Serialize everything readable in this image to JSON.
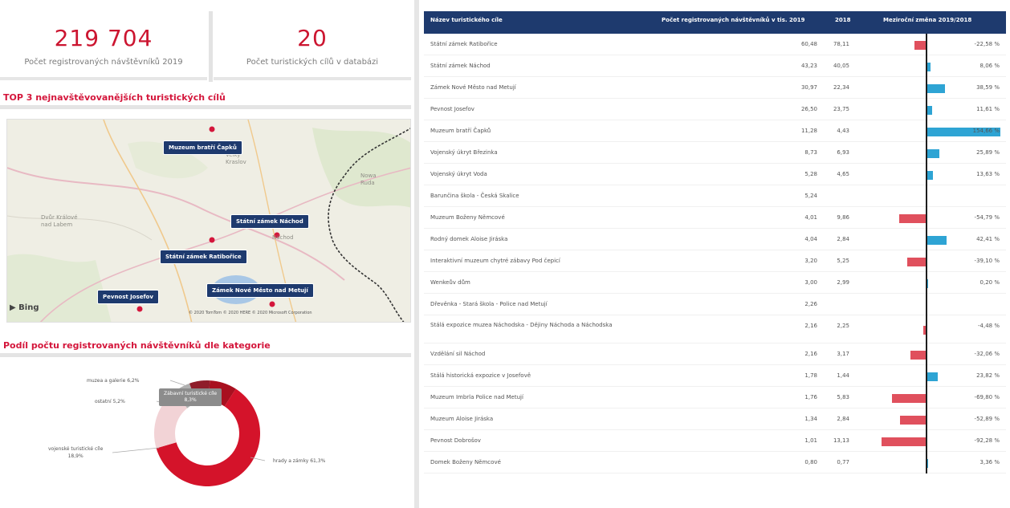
{
  "kpis": [
    {
      "value": "219 704",
      "label": "Počet registrovaných návštěvníků 2019"
    },
    {
      "value": "20",
      "label": "Počet turistických cílů v databázi"
    }
  ],
  "sections": {
    "top3_title": "TOP 3 nejnavštěvovanějších turistických cílů",
    "category_title": "Podíl počtu registrovaných návštěvníků dle kategorie"
  },
  "map": {
    "markers": [
      {
        "label": "Muzeum bratří Čapků"
      },
      {
        "label": "Státní zámek Náchod"
      },
      {
        "label": "Státní zámek Ratibořice"
      },
      {
        "label": "Zámek Nové Město nad Metují"
      },
      {
        "label": "Pevnost Josefov"
      }
    ],
    "bing": "Bing",
    "copyright": "© 2020 TomTom © 2020 HERE © 2020 Microsoft Corporation"
  },
  "donut": {
    "slices": [
      {
        "label": "hrady a zámky",
        "pct": "61,3%",
        "value": 61.3,
        "color": "#d4132a"
      },
      {
        "label": "vojenské turistické cíle",
        "pct": "18,9%",
        "value": 18.9,
        "color": "#f2d3d6"
      },
      {
        "label": "ostatní",
        "pct": "5,2%",
        "value": 5.2,
        "color": "#b0b0b0"
      },
      {
        "label": "muzea a galerie",
        "pct": "6,2%",
        "value": 6.2,
        "color": "#8f1d2a"
      },
      {
        "label": "zábavní turistické cíle",
        "pct": "8,3%",
        "value": 8.3,
        "color": "#a8101f"
      }
    ],
    "tooltip_title": "Zábavní turistické cíle",
    "tooltip_value": "8,3%"
  },
  "table": {
    "headers": {
      "name": "Název turistického cíle",
      "v2019": "Počet registrovaných návštěvníků v tis. 2019",
      "v2018": "2018",
      "change": "Meziroční změna 2019/2018"
    },
    "rows": [
      {
        "name": "Státní zámek Ratibořice",
        "v2019": "60,48",
        "v2018": "78,11",
        "change": "-22,58 %",
        "pct": -22.58
      },
      {
        "name": "Státní zámek Náchod",
        "v2019": "43,23",
        "v2018": "40,05",
        "change": "8,06 %",
        "pct": 8.06
      },
      {
        "name": "Zámek Nové Město nad Metují",
        "v2019": "30,97",
        "v2018": "22,34",
        "change": "38,59 %",
        "pct": 38.59
      },
      {
        "name": "Pevnost Josefov",
        "v2019": "26,50",
        "v2018": "23,75",
        "change": "11,61 %",
        "pct": 11.61
      },
      {
        "name": "Muzeum bratří Čapků",
        "v2019": "11,28",
        "v2018": "4,43",
        "change": "154,66 %",
        "pct": 154.66
      },
      {
        "name": "Vojenský úkryt Březinka",
        "v2019": "8,73",
        "v2018": "6,93",
        "change": "25,89 %",
        "pct": 25.89
      },
      {
        "name": "Vojenský úkryt Voda",
        "v2019": "5,28",
        "v2018": "4,65",
        "change": "13,63 %",
        "pct": 13.63
      },
      {
        "name": "Barunčina škola - Česká Skalice",
        "v2019": "5,24",
        "v2018": "",
        "change": "",
        "pct": null
      },
      {
        "name": "Muzeum Boženy Němcové",
        "v2019": "4,01",
        "v2018": "9,86",
        "change": "-54,79 %",
        "pct": -54.79
      },
      {
        "name": "Rodný domek Aloise Jiráska",
        "v2019": "4,04",
        "v2018": "2,84",
        "change": "42,41 %",
        "pct": 42.41
      },
      {
        "name": "Interaktivní muzeum chytré zábavy Pod čepicí",
        "v2019": "3,20",
        "v2018": "5,25",
        "change": "-39,10 %",
        "pct": -39.1
      },
      {
        "name": "Wenkeův dům",
        "v2019": "3,00",
        "v2018": "2,99",
        "change": "0,20 %",
        "pct": 0.2
      },
      {
        "name": "Dřevěnka - Stará škola - Police nad Metují",
        "v2019": "2,26",
        "v2018": "",
        "change": "",
        "pct": null
      },
      {
        "name": "Stálá expozice muzea Náchodska - Dějiny Náchoda a Náchodska",
        "v2019": "2,16",
        "v2018": "2,25",
        "change": "-4,48 %",
        "pct": -4.48,
        "tall": true
      },
      {
        "name": "Vzdělání sil Náchod",
        "v2019": "2,16",
        "v2018": "3,17",
        "change": "-32,06 %",
        "pct": -32.06
      },
      {
        "name": "Stálá historická expozice v Josefově",
        "v2019": "1,78",
        "v2018": "1,44",
        "change": "23,82 %",
        "pct": 23.82
      },
      {
        "name": "Muzeum Imbrla Police nad Metují",
        "v2019": "1,76",
        "v2018": "5,83",
        "change": "-69,80 %",
        "pct": -69.8
      },
      {
        "name": "Muzeum Aloise Jiráska",
        "v2019": "1,34",
        "v2018": "2,84",
        "change": "-52,89 %",
        "pct": -52.89
      },
      {
        "name": "Pevnost Dobrošov",
        "v2019": "1,01",
        "v2018": "13,13",
        "change": "-92,28 %",
        "pct": -92.28
      },
      {
        "name": "Domek Boženy Němcové",
        "v2019": "0,80",
        "v2018": "0,77",
        "change": "3,36 %",
        "pct": 3.36
      }
    ]
  },
  "colors": {
    "accent": "#cc1530",
    "header": "#1e3a6e",
    "bar_positive": "#2ea4d4",
    "bar_negative": "#e0505d"
  }
}
